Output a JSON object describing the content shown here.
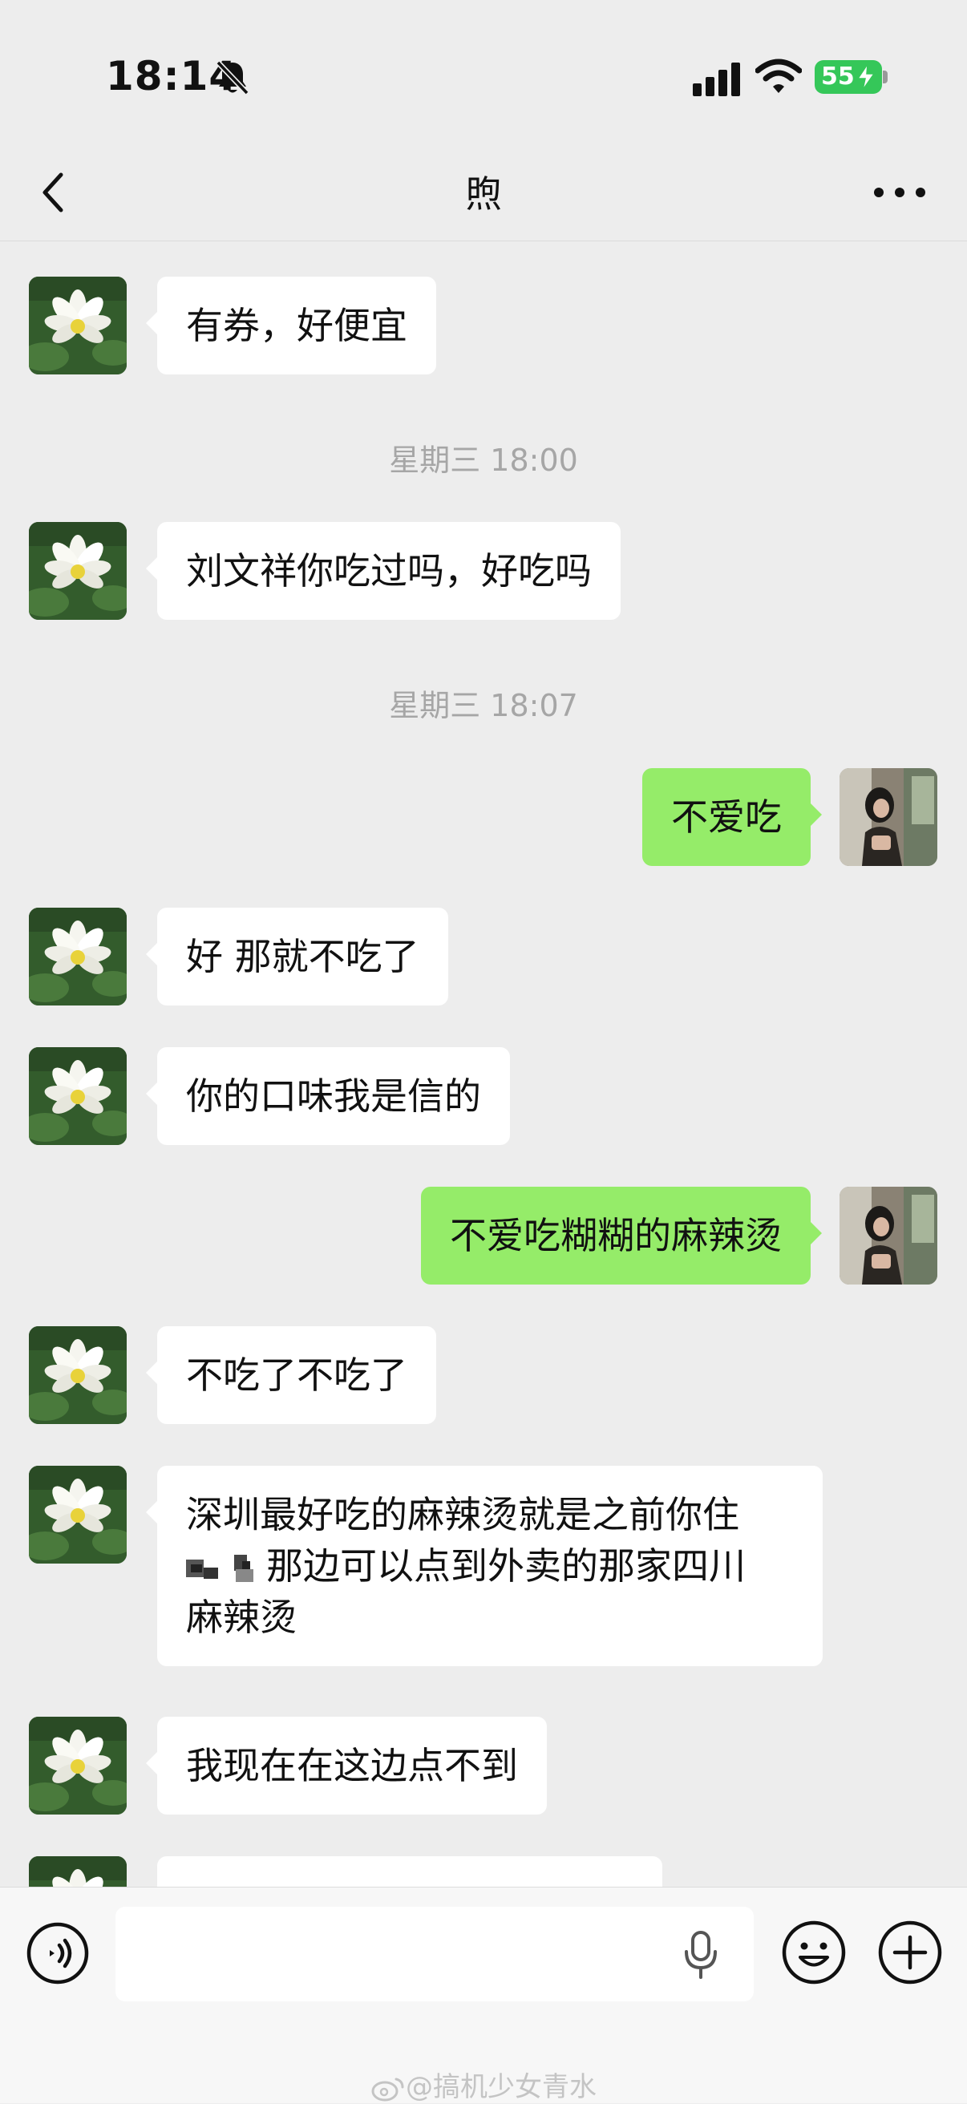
{
  "status_bar": {
    "time": "18:14",
    "battery": "55",
    "icons": [
      "bell-slash-icon",
      "signal-icon",
      "wifi-icon",
      "battery-icon",
      "bolt-icon"
    ]
  },
  "nav": {
    "title": "煦",
    "icons": [
      "chevron-left-icon",
      "more-icon"
    ]
  },
  "messages": [
    {
      "side": "left",
      "text": "有券，好便宜"
    },
    {
      "timestamp": "星期三 18:00"
    },
    {
      "side": "left",
      "text": "刘文祥你吃过吗，好吃吗"
    },
    {
      "timestamp": "星期三 18:07"
    },
    {
      "side": "right",
      "text": "不爱吃"
    },
    {
      "side": "left",
      "text": "好 那就不吃了"
    },
    {
      "side": "left",
      "text": "你的口味我是信的"
    },
    {
      "side": "right",
      "text": "不爱吃糊糊的麻辣烫"
    },
    {
      "side": "left",
      "text": "不吃了不吃了"
    },
    {
      "side": "left",
      "lines": [
        "深圳最好吃的麻辣烫就是之前你住",
        "那边可以点到外卖的那家四川",
        "麻辣烫"
      ]
    },
    {
      "side": "left",
      "text": "我现在在这边点不到"
    }
  ],
  "input_bar": {
    "value": "",
    "icons": [
      "voice-icon",
      "mic-icon",
      "emoji-icon",
      "plus-icon"
    ]
  },
  "watermark": "@搞机少女青水",
  "colors": {
    "background": "#ededed",
    "incoming_bubble": "#ffffff",
    "outgoing_bubble": "#95ec69",
    "timestamp": "#a6a6a6",
    "battery": "#35c759"
  }
}
